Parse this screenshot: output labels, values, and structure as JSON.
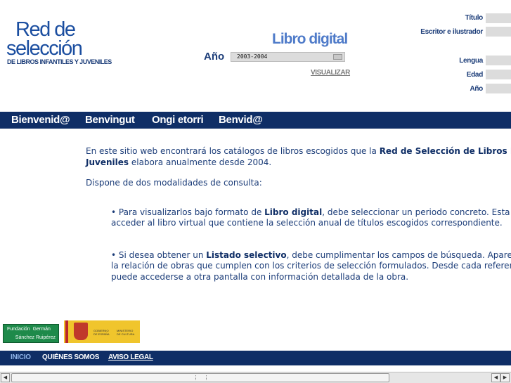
{
  "logo": {
    "line1": "Red de",
    "line2": "selección",
    "subtitle": "DE LIBROS INFANTILES Y JUVENILES"
  },
  "libro_digital": {
    "title": "Libro digital",
    "year_label": "Año",
    "year_value": "2003-2004",
    "visualizar": "VISUALIZAR"
  },
  "search_form": {
    "titulo": "Título",
    "escritor": "Escritor e ilustrador",
    "lengua": "Lengua",
    "edad": "Edad",
    "ano": "Año"
  },
  "nav": {
    "items": [
      "Bienvenid@",
      "Benvingut",
      "Ongi etorri",
      "Benvid@"
    ]
  },
  "content": {
    "p1_a": "En este sitio web encontrará los catálogos de libros escogidos que la ",
    "p1_b": "Red de Selección de Libros I",
    "p1_c": "Juveniles",
    "p1_d": " elabora anualmente desde 2004.",
    "p2": "Dispone de dos modalidades de consulta:",
    "b1_a": "• Para visualizarlos bajo formato de ",
    "b1_b": "Libro digital",
    "b1_c": ", debe seleccionar un periodo concreto. Esta acc",
    "b1_d": "acceder al libro virtual que contiene la selección anual de títulos escogidos correspondiente.",
    "b2_a": "• Si desea obtener un ",
    "b2_b": "Listado selectivo",
    "b2_c": ", debe cumplimentar los campos de búsqueda. Aparec",
    "b2_d": "la relación de obras que cumplen con los criterios de selección formulados. Desde cada referenci",
    "b2_e": "puede accederse a otra pantalla con información detallada de la obra."
  },
  "sponsors": {
    "fgsr_line1": "Fundación  Germán",
    "fgsr_line2": "Sánchez Ruipérez",
    "gob_line1": "GOBIERNO\nDE ESPAÑA",
    "gob_line2": "MINISTERIO\nDE CULTURA"
  },
  "footer": {
    "items": [
      "INICIO",
      "QUIÉNES SOMOS",
      "AVISO LEGAL"
    ]
  },
  "scrollbar": {
    "left_arrow": "◀",
    "right_arrow": "▶"
  }
}
